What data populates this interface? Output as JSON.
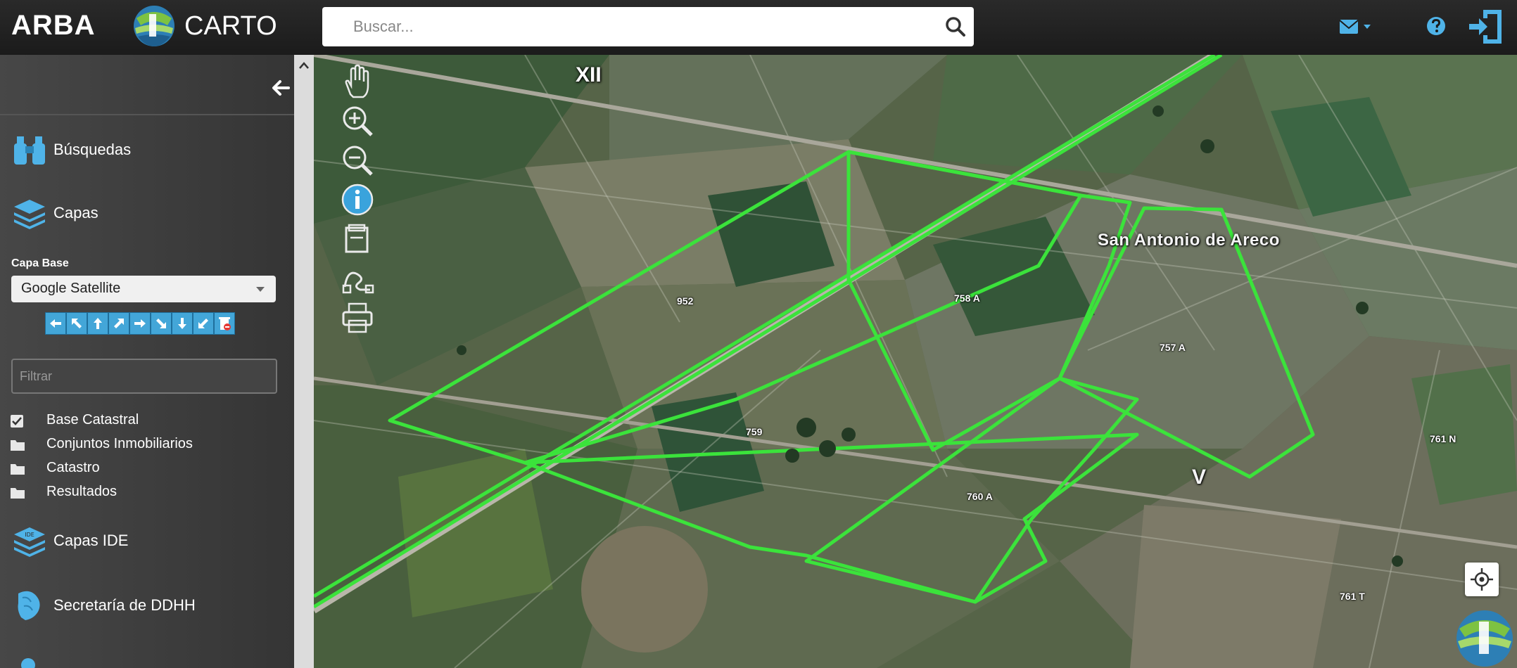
{
  "header": {
    "brand": "ARBA",
    "carto_logo_text": "CARTO",
    "search_placeholder": "Buscar...",
    "icons": [
      "search-icon",
      "mail-icon",
      "help-icon",
      "exit-icon"
    ]
  },
  "sidebar": {
    "items": [
      {
        "label": "Búsquedas",
        "icon": "binoculars-icon"
      },
      {
        "label": "Capas",
        "icon": "layers-icon"
      },
      {
        "label": "Capas IDE",
        "icon": "layers-ide-icon"
      },
      {
        "label": "Secretaría de DDHH",
        "icon": "ddhh-icon"
      }
    ],
    "capa_base_label": "Capa Base",
    "capa_base_value": "Google Satellite",
    "filter_placeholder": "Filtrar",
    "layers": [
      {
        "label": "Base Catastral",
        "icon": "checkbox-checked-icon"
      },
      {
        "label": "Conjuntos Inmobiliarios",
        "icon": "folder-icon"
      },
      {
        "label": "Catastro",
        "icon": "folder-icon"
      },
      {
        "label": "Resultados",
        "icon": "folder-icon"
      }
    ]
  },
  "map": {
    "region_label": "XII",
    "town_label": "San Antonio de Areco",
    "parcels": [
      "952",
      "758 A",
      "757 A",
      "759",
      "760 A",
      "761 N",
      "761 T",
      "V"
    ],
    "tools": [
      "pan-hand-icon",
      "zoom-in-icon",
      "zoom-out-icon",
      "info-icon",
      "layers-tool-icon",
      "measure-icon",
      "print-icon"
    ],
    "highlight_color": "#3be33b"
  }
}
